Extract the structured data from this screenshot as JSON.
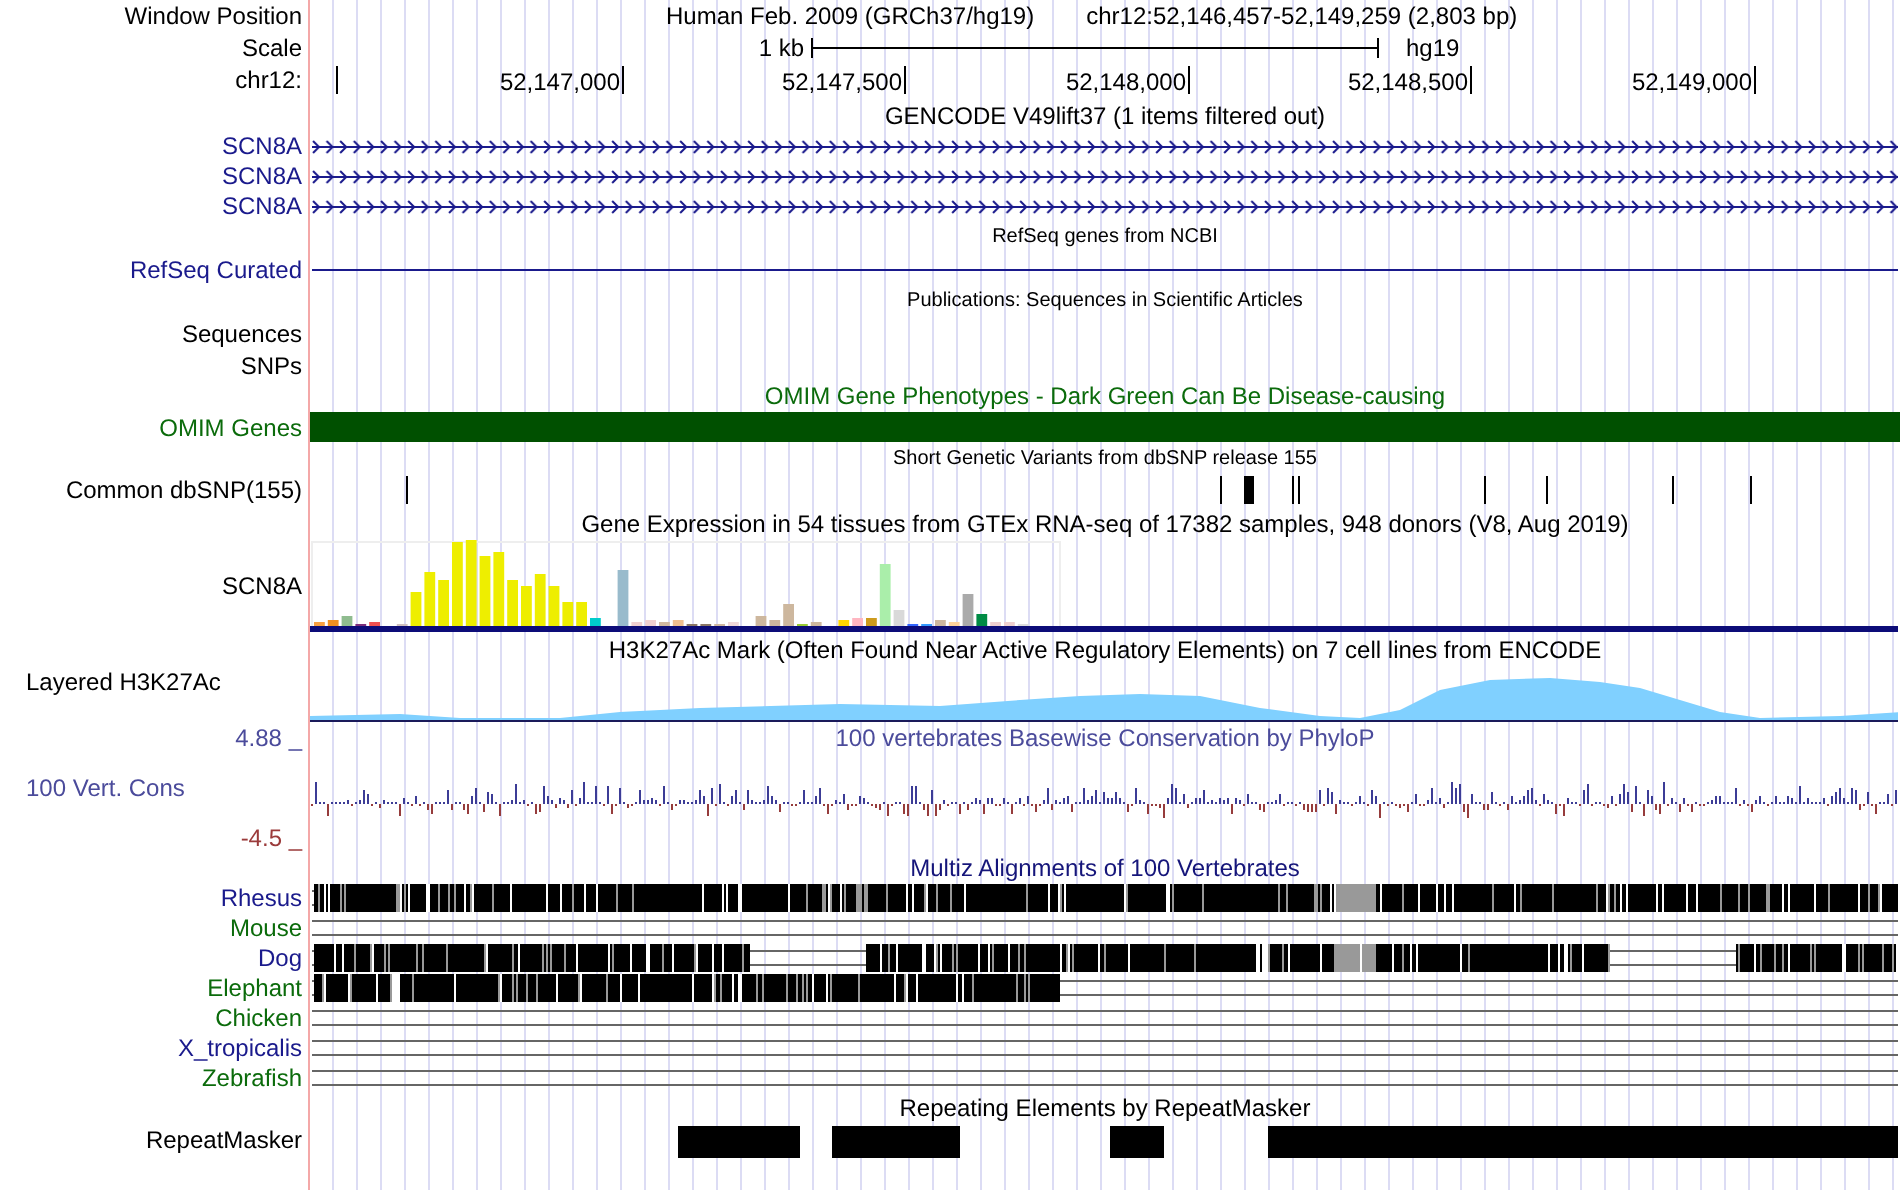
{
  "header": {
    "position": {
      "label": "Window Position",
      "assembly": "Human Feb. 2009 (GRCh37/hg19)",
      "range": "chr12:52,146,457-52,149,259 (2,803 bp)"
    },
    "scale": {
      "label": "Scale",
      "length": "1 kb",
      "assembly": "hg19"
    },
    "ruler": {
      "label": "chr12:",
      "ticks": [
        "52,147,000",
        "52,147,500",
        "52,148,000",
        "52,148,500",
        "52,149,000"
      ]
    }
  },
  "tracks": [
    {
      "kind": "genes",
      "title": "GENCODE V49lift37 (1 items filtered out)",
      "rows": [
        {
          "label": "SCN8A"
        },
        {
          "label": "SCN8A"
        },
        {
          "label": "SCN8A"
        }
      ]
    },
    {
      "kind": "line",
      "title": "RefSeq genes from NCBI",
      "label": "RefSeq Curated"
    },
    {
      "kind": "empty",
      "title": "Publications: Sequences in Scientific Articles",
      "labels": [
        "Sequences",
        "SNPs"
      ]
    },
    {
      "kind": "bar",
      "title": "OMIM Gene Phenotypes - Dark Green Can Be Disease-causing",
      "label": "OMIM Genes"
    },
    {
      "kind": "variants",
      "title": "Short Genetic Variants from dbSNP release 155",
      "label": "Common dbSNP(155)"
    },
    {
      "kind": "expression",
      "title": "Gene Expression in 54 tissues from GTEx RNA-seq of 17382 samples, 948 donors (V8, Aug 2019)",
      "label": "SCN8A"
    },
    {
      "kind": "signal",
      "title": "H3K27Ac Mark (Often Found Near Active Regulatory Elements) on 7 cell lines from ENCODE",
      "label": "Layered H3K27Ac"
    },
    {
      "kind": "wiggle",
      "title": "100 vertebrates Basewise Conservation by PhyloP",
      "label": "100 Vert. Cons",
      "max": "4.88 _",
      "min": "-4.5 _"
    },
    {
      "kind": "alignment",
      "title": "Multiz Alignments of 100 Vertebrates",
      "species": [
        {
          "name": "Rhesus",
          "color": "#1a1a8c"
        },
        {
          "name": "Mouse",
          "color": "#0b6b0b"
        },
        {
          "name": "Dog",
          "color": "#1a1a8c"
        },
        {
          "name": "Elephant",
          "color": "#0b6b0b"
        },
        {
          "name": "Chicken",
          "color": "#0b6b0b"
        },
        {
          "name": "X_tropicalis",
          "color": "#1a1a8c"
        },
        {
          "name": "Zebrafish",
          "color": "#0b6b0b"
        }
      ]
    },
    {
      "kind": "repeats",
      "title": "Repeating Elements by RepeatMasker",
      "label": "RepeatMasker"
    }
  ]
}
